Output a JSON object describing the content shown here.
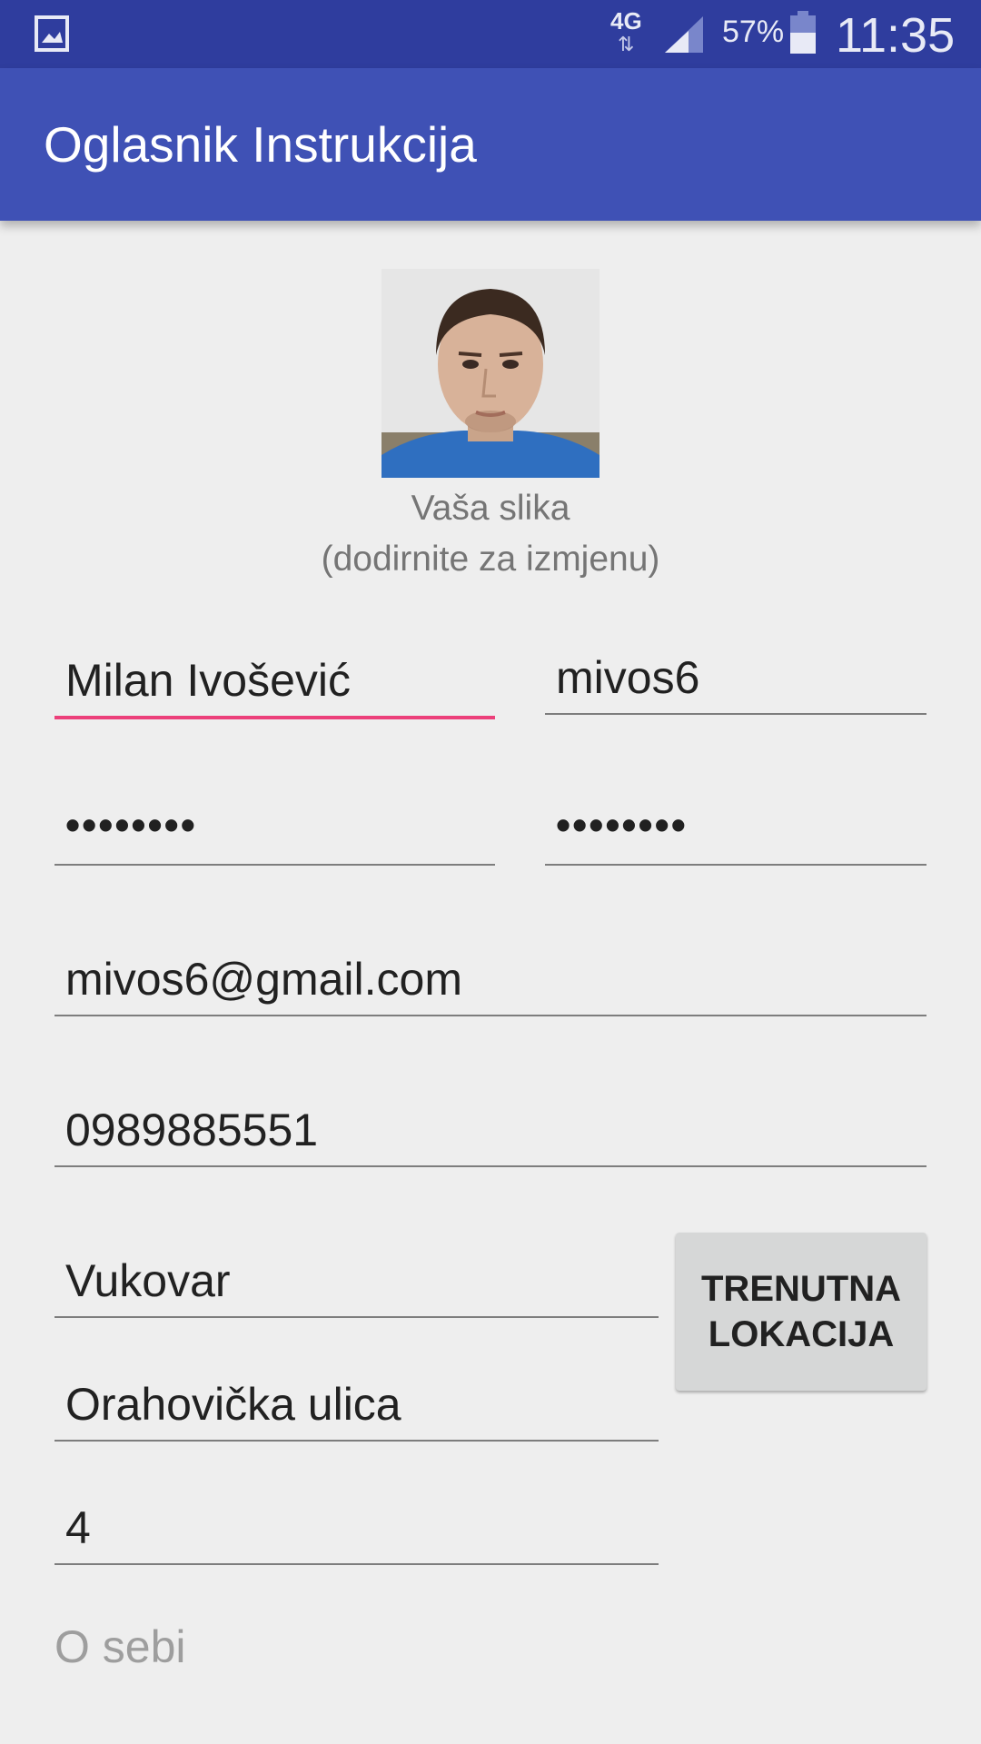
{
  "status_bar": {
    "network": "4G",
    "network_arrows": "⇅",
    "battery_percent": "57%",
    "time": "11:35",
    "icons": [
      "gallery-icon",
      "signal-icon",
      "battery-icon"
    ]
  },
  "app_bar": {
    "title": "Oglasnik Instrukcija"
  },
  "profile": {
    "photo_caption_line1": "Vaša slika",
    "photo_caption_line2": "(dodirnite za izmjenu)"
  },
  "form": {
    "full_name": "Milan Ivošević",
    "username": "mivos6",
    "password": "••••••••",
    "password_repeat": "••••••••",
    "email": "mivos6@gmail.com",
    "phone": "0989885551",
    "city": "Vukovar",
    "street": "Orahovička ulica",
    "house_number": "4",
    "about_placeholder": "O sebi",
    "location_button": "TRENUTNA\nLOKACIJA"
  },
  "colors": {
    "status_bar": "#2f3d9e",
    "app_bar": "#3f51b5",
    "accent": "#ec407a",
    "background": "#eeeeee"
  }
}
